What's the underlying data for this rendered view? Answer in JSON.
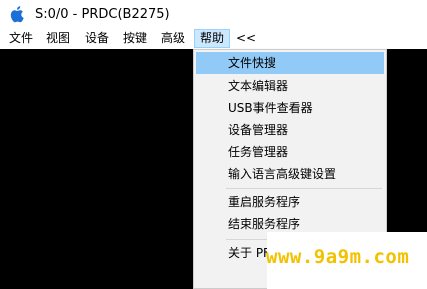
{
  "window": {
    "title": "S:0/0 - PRDC(B2275)"
  },
  "menubar": {
    "items": [
      "文件",
      "视图",
      "设备",
      "按键",
      "高级",
      "帮助",
      "<<"
    ],
    "active_index": 5
  },
  "help_menu": {
    "items": [
      "文件快搜",
      "文本编辑器",
      "USB事件查看器",
      "设备管理器",
      "任务管理器",
      "输入语言高级键设置",
      "重启服务程序",
      "结束服务程序",
      "关于 PF"
    ],
    "highlighted_index": 0
  },
  "watermark": {
    "text": "www.9a9m.com"
  },
  "colors": {
    "content_bg": "#000000",
    "menu_bg": "#f2f2f2",
    "highlight": "#91c9f7",
    "active_menu": "#cce8ff",
    "watermark": "#f2c200"
  }
}
